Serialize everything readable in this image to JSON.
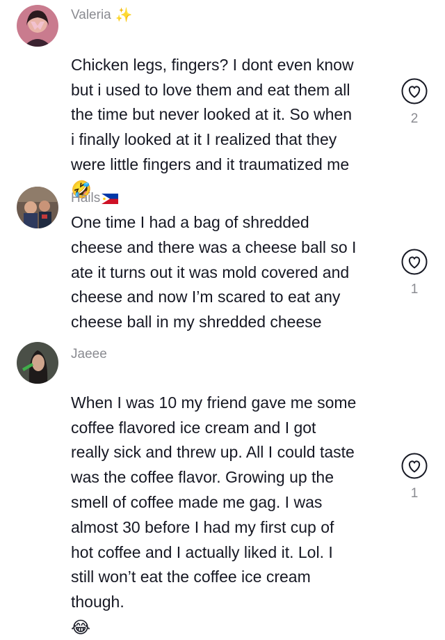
{
  "comments": [
    {
      "username": "Valeria",
      "badge": "✨",
      "text": "Chicken legs, fingers? I dont even know\nbut i used to love them and eat them all\nthe time but never looked at it. So when\ni finally looked at it I realized that they\nwere little fingers and it traumatized me",
      "trailing_emoji": "🤣",
      "likes": "2"
    },
    {
      "username": "Hails",
      "flag": "philippines-flag",
      "text": "One time I had a bag of shredded\ncheese and there was a cheese ball so I\nate it turns out it was mold covered and\ncheese and now I’m scared to eat any\ncheese ball in my shredded cheese",
      "likes": "1"
    },
    {
      "username": "Jaeee",
      "text": "When I was 10 my friend gave me some\ncoffee flavored ice cream and I got\nreally sick and threw up. All I could taste\nwas the coffee flavor. Growing up the\nsmell of coffee made me gag. I was\nalmost 30 before I had my first cup of\nhot coffee and I actually liked it. Lol. I\nstill won’t eat the coffee ice cream\nthough.",
      "trailing_emoji": "😂",
      "likes": "1"
    }
  ],
  "colors": {
    "text": "#161823",
    "meta": "#8a8b91",
    "icon": "#161823"
  },
  "icons": {
    "like": "heart-outline-icon"
  }
}
